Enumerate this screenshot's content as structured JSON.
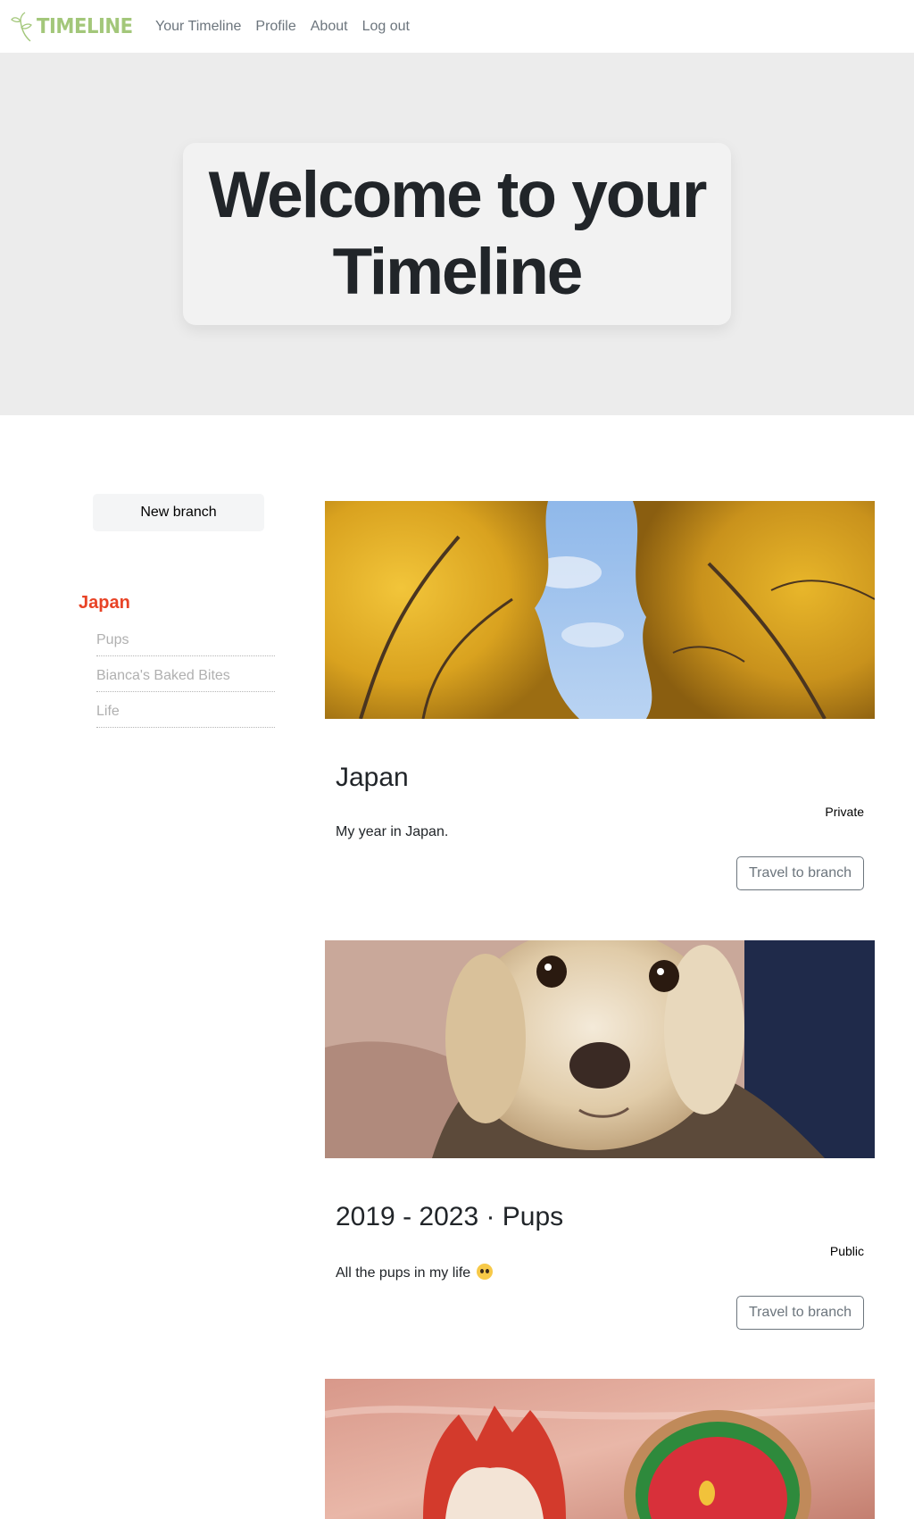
{
  "nav": {
    "brand": "TIMELINE",
    "links": [
      "Your Timeline",
      "Profile",
      "About",
      "Log out"
    ]
  },
  "hero": {
    "title_line1": "Welcome to your",
    "title_line2": "Timeline"
  },
  "sidebar": {
    "new_branch_label": "New branch",
    "current_branch": "Japan",
    "branches": [
      "Pups",
      "Bianca's Baked Bites",
      "Life"
    ]
  },
  "cards": [
    {
      "title": "Japan",
      "visibility": "Private",
      "description": "My year in Japan.",
      "button_label": "Travel to branch"
    },
    {
      "title": "2019 - 2023 · Pups",
      "visibility": "Public",
      "description": "All the pups in my life",
      "button_label": "Travel to branch"
    }
  ],
  "colors": {
    "brand": "#a3c77a",
    "current_branch": "#e84326",
    "hero_bg": "#ececec"
  },
  "icons": {
    "brand_icon": "sprout-icon",
    "emoji": "pleading-face-emoji"
  }
}
